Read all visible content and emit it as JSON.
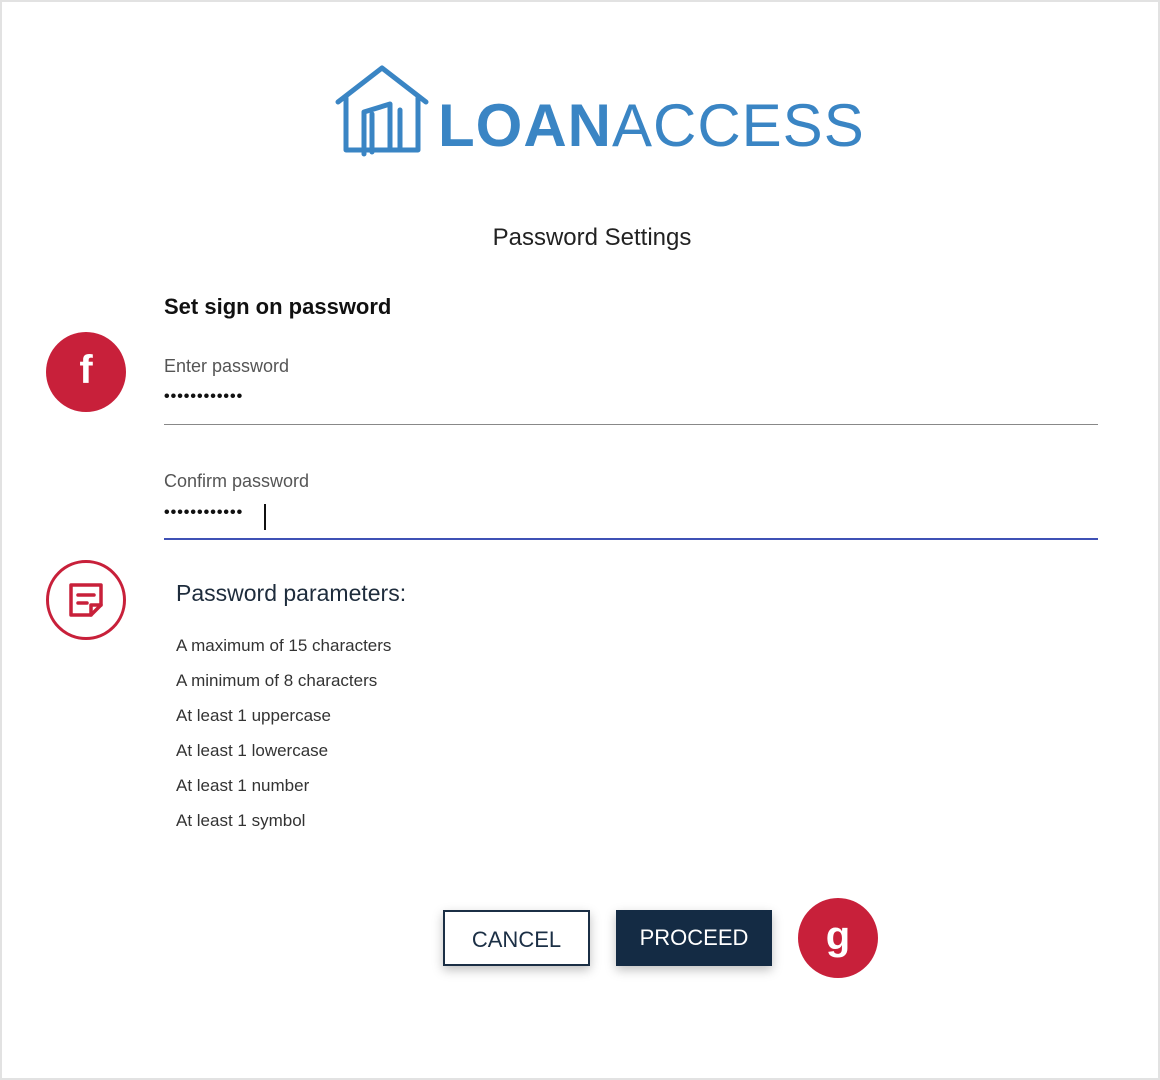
{
  "brand": {
    "name_bold": "LOAN",
    "name_light": "ACCESS",
    "color": "#3a85c4"
  },
  "page": {
    "title": "Password Settings"
  },
  "form": {
    "section_title": "Set sign on password",
    "enter_password": {
      "label": "Enter password",
      "value": "••••••••••••"
    },
    "confirm_password": {
      "label": "Confirm password",
      "value": "••••••••••••"
    }
  },
  "markers": {
    "f": "f",
    "g": "g",
    "note_icon": "note-icon",
    "color": "#c8203a"
  },
  "parameters": {
    "title": "Password parameters:",
    "items": [
      "A maximum of 15 characters",
      "A minimum of 8 characters",
      "At least 1 uppercase",
      "At least 1 lowercase",
      "At least 1 number",
      "At least 1 symbol"
    ]
  },
  "buttons": {
    "cancel": "CANCEL",
    "proceed": "PROCEED",
    "primary_color": "#142b44"
  }
}
